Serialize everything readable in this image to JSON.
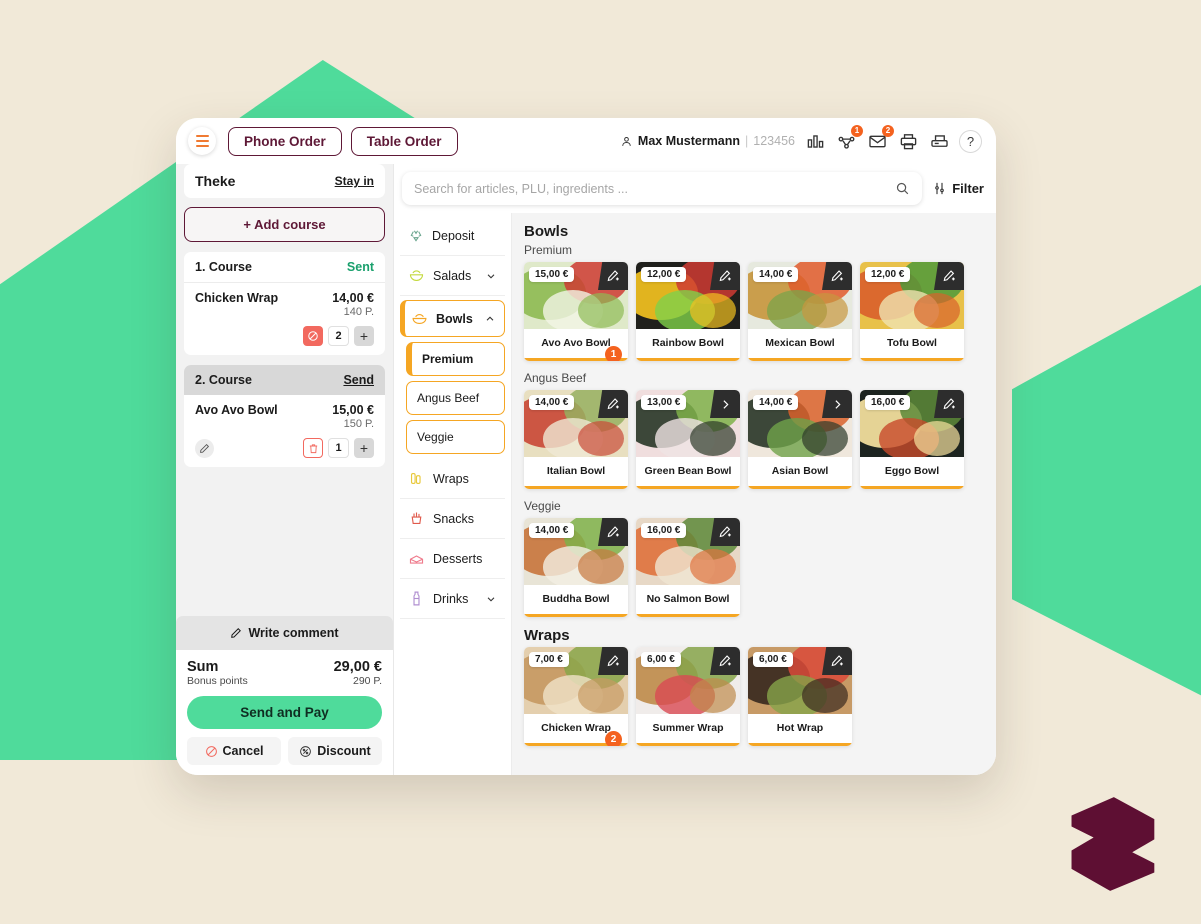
{
  "theme": {
    "bg": "#f1e9d8",
    "accent_green": "#4fdb9b",
    "accent_orange": "#f5a623",
    "brand_maroon": "#5e1836",
    "badge_orange": "#f4621f"
  },
  "topbar": {
    "menu_icon": "hamburger-icon",
    "tabs": [
      {
        "label": "Phone Order"
      },
      {
        "label": "Table Order"
      }
    ],
    "user": {
      "icon": "person-icon",
      "name": "Max Mustermann",
      "separator": "|",
      "id": "123456"
    },
    "icons": [
      {
        "name": "stats-icon",
        "badge": ""
      },
      {
        "name": "share-network-icon",
        "badge": "1"
      },
      {
        "name": "mail-icon",
        "badge": "2"
      },
      {
        "name": "printer-icon",
        "badge": ""
      },
      {
        "name": "scanner-icon",
        "badge": ""
      }
    ],
    "help_label": "?"
  },
  "order_panel": {
    "location": "Theke",
    "stay_link": "Stay in",
    "add_course_label": "+ Add course",
    "courses": [
      {
        "title": "1. Course",
        "status": "Sent",
        "status_type": "sent",
        "items": [
          {
            "name": "Chicken Wrap",
            "price": "14,00 €",
            "points": "140 P.",
            "qty": "2",
            "has_edit": false,
            "left_action": "void-icon",
            "plus": "+"
          }
        ]
      },
      {
        "title": "2. Course",
        "status": "Send",
        "status_type": "send",
        "items": [
          {
            "name": "Avo Avo Bowl",
            "price": "15,00 €",
            "points": "150 P.",
            "qty": "1",
            "has_edit": true,
            "left_action": "trash-icon",
            "plus": "+"
          }
        ]
      }
    ],
    "write_comment_label": "Write comment",
    "totals": {
      "sum_label": "Sum",
      "sum_value": "29,00 €",
      "bonus_label": "Bonus points",
      "bonus_value": "290 P."
    },
    "pay_label": "Send and Pay",
    "cancel_label": "Cancel",
    "discount_label": "Discount"
  },
  "search": {
    "placeholder": "Search for articles, PLU, ingredients ...",
    "value": "",
    "search_icon": "search-icon",
    "filter_label": "Filter",
    "filter_icon": "sliders-icon"
  },
  "categories": [
    {
      "label": "Deposit",
      "icon": "recycle-icon",
      "expandable": false,
      "active": false
    },
    {
      "label": "Salads",
      "icon": "salad-icon",
      "expandable": true,
      "chevron": "down",
      "active": false
    },
    {
      "label": "Bowls",
      "icon": "bowl-icon",
      "expandable": true,
      "chevron": "up",
      "active": true,
      "subcategories": [
        {
          "label": "Premium",
          "selected": true
        },
        {
          "label": "Angus Beef",
          "selected": false
        },
        {
          "label": "Veggie",
          "selected": false
        }
      ]
    },
    {
      "label": "Wraps",
      "icon": "wrap-icon",
      "expandable": false,
      "active": false
    },
    {
      "label": "Snacks",
      "icon": "fries-icon",
      "expandable": false,
      "active": false
    },
    {
      "label": "Desserts",
      "icon": "cake-icon",
      "expandable": false,
      "active": false
    },
    {
      "label": "Drinks",
      "icon": "bottle-icon",
      "expandable": true,
      "chevron": "down",
      "active": false
    }
  ],
  "catalog": [
    {
      "heading": "Bowls",
      "heading_level": "main",
      "subheading": "Premium",
      "products": [
        {
          "name": "Avo Avo Bowl",
          "price": "15,00 €",
          "corner": "edit-plus-icon",
          "badge": "1",
          "img": "green-salad"
        },
        {
          "name": "Rainbow Bowl",
          "price": "12,00 €",
          "corner": "edit-plus-icon",
          "badge": "",
          "img": "rainbow"
        },
        {
          "name": "Mexican Bowl",
          "price": "14,00 €",
          "corner": "edit-plus-icon",
          "badge": "",
          "img": "mexican"
        },
        {
          "name": "Tofu Bowl",
          "price": "12,00 €",
          "corner": "edit-plus-icon",
          "badge": "",
          "img": "tofu"
        }
      ]
    },
    {
      "heading": "",
      "heading_level": "none",
      "subheading": "Angus Beef",
      "products": [
        {
          "name": "Italian Bowl",
          "price": "14,00 €",
          "corner": "edit-plus-icon",
          "badge": "",
          "img": "italian"
        },
        {
          "name": "Green Bean Bowl",
          "price": "13,00 €",
          "corner": "chevron-right-icon",
          "badge": "",
          "img": "greenbean"
        },
        {
          "name": "Asian Bowl",
          "price": "14,00 €",
          "corner": "chevron-right-icon",
          "badge": "",
          "img": "asian"
        },
        {
          "name": "Eggo Bowl",
          "price": "16,00 €",
          "corner": "edit-plus-icon",
          "badge": "",
          "img": "eggo"
        }
      ]
    },
    {
      "heading": "",
      "heading_level": "none",
      "subheading": "Veggie",
      "products": [
        {
          "name": "Buddha Bowl",
          "price": "14,00 €",
          "corner": "edit-plus-icon",
          "badge": "",
          "img": "buddha"
        },
        {
          "name": "No Salmon Bowl",
          "price": "16,00 €",
          "corner": "edit-plus-icon",
          "badge": "",
          "img": "nosalmon"
        }
      ]
    },
    {
      "heading": "Wraps",
      "heading_level": "main",
      "subheading": "",
      "products": [
        {
          "name": "Chicken Wrap",
          "price": "7,00 €",
          "corner": "edit-plus-icon",
          "badge": "2",
          "img": "chickenwrap"
        },
        {
          "name": "Summer Wrap",
          "price": "6,00 €",
          "corner": "edit-plus-icon",
          "badge": "",
          "img": "summerwrap"
        },
        {
          "name": "Hot Wrap",
          "price": "6,00 €",
          "corner": "edit-plus-icon",
          "badge": "",
          "img": "hotwrap"
        }
      ]
    }
  ]
}
